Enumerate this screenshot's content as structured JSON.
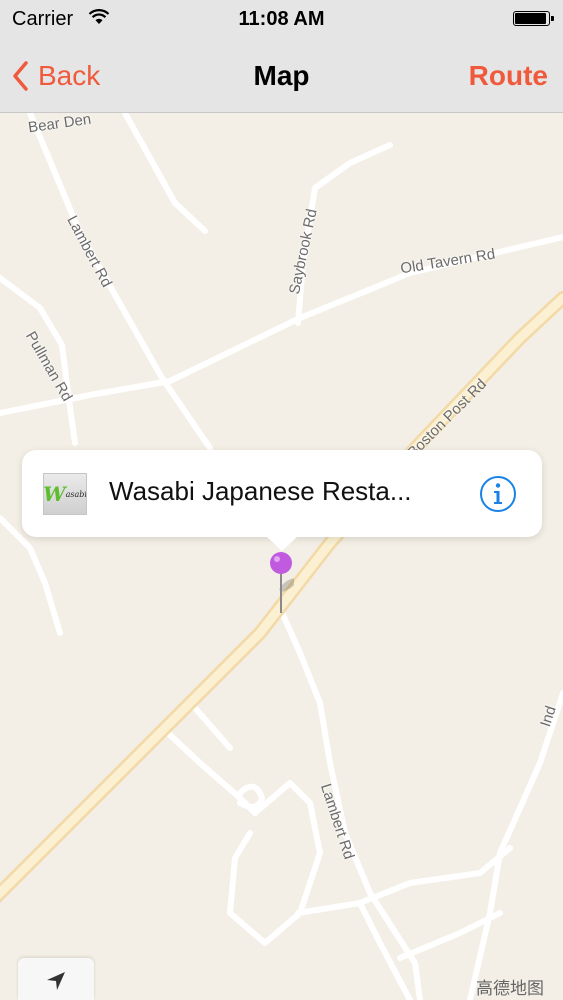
{
  "status_bar": {
    "carrier": "Carrier",
    "time": "11:08 AM",
    "battery_level": 0.95
  },
  "nav_bar": {
    "back_label": "Back",
    "title": "Map",
    "route_label": "Route"
  },
  "map": {
    "road_labels": {
      "bear_den": "Bear Den",
      "lambert_north": "Lambert Rd",
      "saybrook": "Saybrook Rd",
      "old_tavern": "Old Tavern Rd",
      "pullman": "Pullman Rd",
      "boston_post": "Boston Post Rd",
      "lambert_south": "Lambert Rd",
      "ind": "Ind"
    },
    "attribution": "高德地图"
  },
  "callout": {
    "title": "Wasabi Japanese Resta...",
    "thumbnail_w": "W",
    "thumbnail_rest": "asabi",
    "info_icon": "info-icon"
  },
  "colors": {
    "accent": "#f05a3c",
    "info_blue": "#1a82e6",
    "pin_purple": "#c05be0"
  }
}
